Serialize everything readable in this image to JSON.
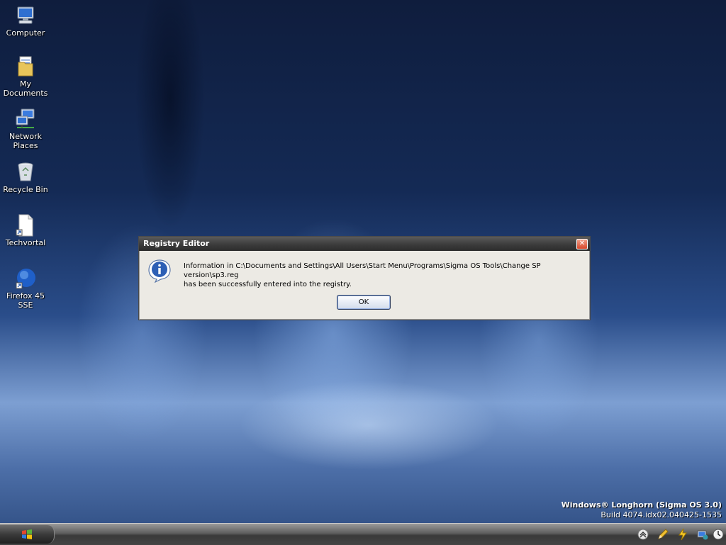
{
  "desktop": {
    "icons": [
      {
        "label": "Computer",
        "icon": "computer-icon"
      },
      {
        "label": "My Documents",
        "icon": "folder-documents-icon"
      },
      {
        "label": "Network Places",
        "icon": "network-icon"
      },
      {
        "label": "Recycle Bin",
        "icon": "recycle-bin-icon"
      },
      {
        "label": "Techvortal",
        "icon": "document-shortcut-icon"
      },
      {
        "label": "Firefox 45 SSE",
        "icon": "firefox-icon"
      }
    ]
  },
  "dialog": {
    "title": "Registry Editor",
    "close_label": "✕",
    "icon": "information-icon",
    "message_line1": "Information in C:\\Documents and Settings\\All Users\\Start Menu\\Programs\\Sigma OS Tools\\Change SP version\\sp3.reg",
    "message_line2": "has been successfully entered into the registry.",
    "ok_label": "OK"
  },
  "branding": {
    "line1": "Windows® Longhorn (Sigma OS 3.0)",
    "line2": "Build 4074.idx02.040425-1535"
  },
  "taskbar": {
    "start_icon": "windows-flag-icon",
    "tray_icons": [
      "show-hidden-icons-icon",
      "pencil-icon",
      "lightning-icon",
      "network-tray-icon",
      "clock-icon"
    ]
  },
  "colors": {
    "dialog_bg": "#eceae4",
    "title_bar": "#3c3c3c",
    "close_button": "#d8472a"
  }
}
